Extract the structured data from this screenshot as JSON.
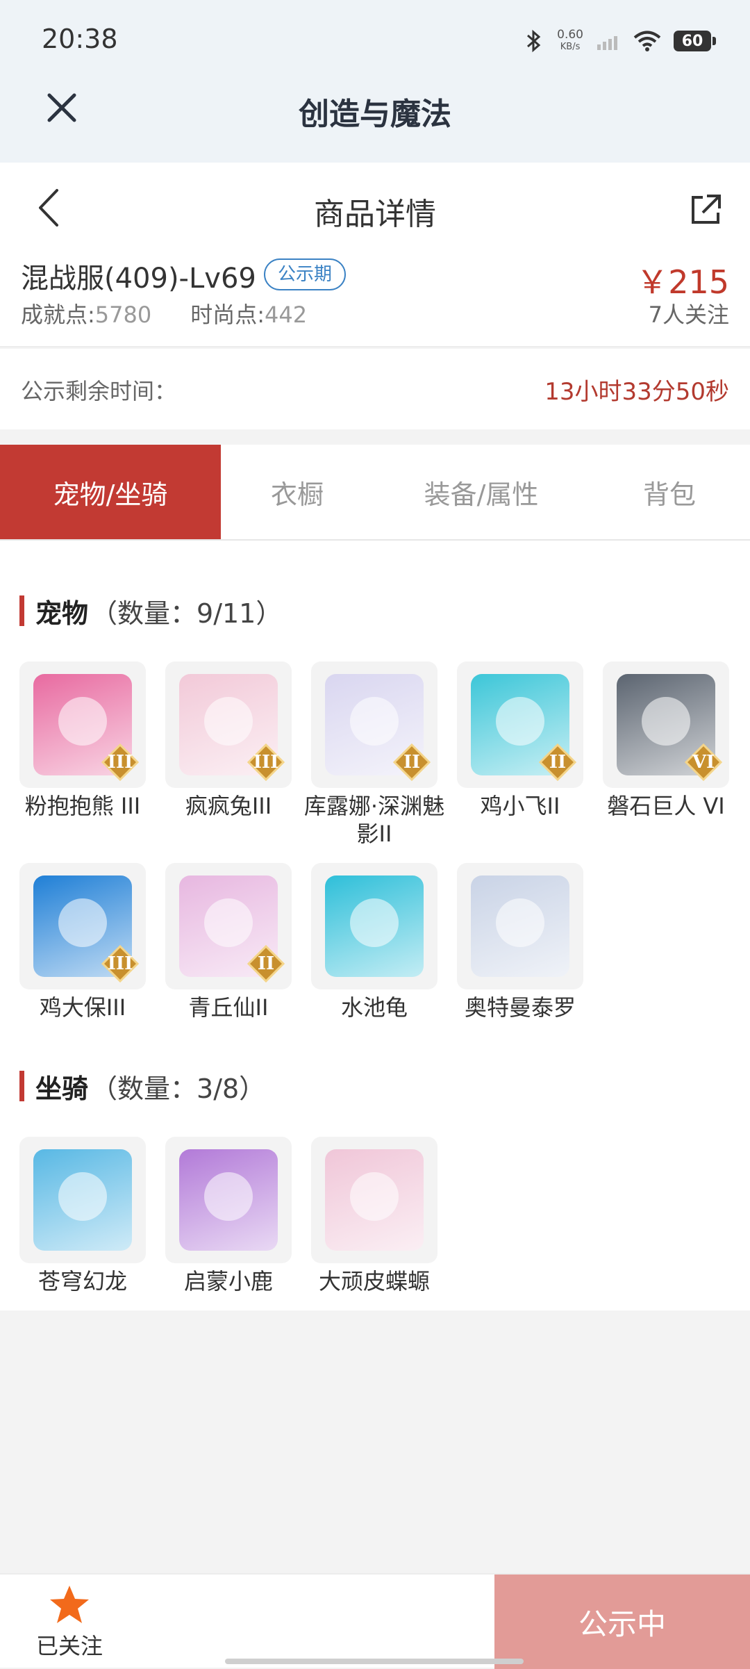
{
  "status_bar": {
    "time": "20:38",
    "net_speed": "0.60",
    "net_unit": "KB/s",
    "battery": "60"
  },
  "app_header": {
    "title": "创造与魔法"
  },
  "nav": {
    "title": "商品详情"
  },
  "product": {
    "name": "混战服(409)-Lv69",
    "tag": "公示期",
    "price": "￥215",
    "achievement_label": "成就点:",
    "achievement_value": "5780",
    "fashion_label": "时尚点:",
    "fashion_value": "442",
    "watchers": "7人关注"
  },
  "countdown": {
    "label": "公示剩余时间：",
    "value": "13小时33分50秒"
  },
  "tabs": [
    {
      "label": "宠物/坐骑",
      "active": true
    },
    {
      "label": "衣橱",
      "active": false
    },
    {
      "label": "装备/属性",
      "active": false
    },
    {
      "label": "背包",
      "active": false
    }
  ],
  "pets": {
    "title": "宠物",
    "count": "（数量：9/11）",
    "items": [
      {
        "name": "粉抱抱熊 III",
        "badge": "III",
        "icon": "pink-bear-icon",
        "color": "#e86aa0"
      },
      {
        "name": "疯疯兔III",
        "badge": "III",
        "icon": "crazy-rabbit-icon",
        "color": "#f2c9d8"
      },
      {
        "name": "库露娜·深渊魅影II",
        "badge": "II",
        "icon": "kuluna-icon",
        "color": "#d9d6f0"
      },
      {
        "name": "鸡小飞II",
        "badge": "II",
        "icon": "chick-icon",
        "color": "#3cc6d8"
      },
      {
        "name": "磐石巨人 VI",
        "badge": "VI",
        "icon": "rock-giant-icon",
        "color": "#5b6470"
      },
      {
        "name": "鸡大保III",
        "badge": "III",
        "icon": "blue-bird-icon",
        "color": "#1f7fd6"
      },
      {
        "name": "青丘仙II",
        "badge": "II",
        "icon": "fox-fairy-icon",
        "color": "#e7b7e0"
      },
      {
        "name": "水池龟",
        "badge": "",
        "icon": "pool-turtle-icon",
        "color": "#2ebfd9"
      },
      {
        "name": "奥特曼泰罗",
        "badge": "",
        "icon": "ultraman-taro-icon",
        "color": "#c9d3e6"
      }
    ]
  },
  "mounts": {
    "title": "坐骑",
    "count": "（数量：3/8）",
    "items": [
      {
        "name": "苍穹幻龙",
        "badge": "",
        "icon": "sky-dragon-icon",
        "color": "#58b8e4"
      },
      {
        "name": "启蒙小鹿",
        "badge": "",
        "icon": "little-deer-icon",
        "color": "#b27ad8"
      },
      {
        "name": "大顽皮蝶螈",
        "badge": "",
        "icon": "axolotl-icon",
        "color": "#f0c6d8"
      }
    ]
  },
  "bottom_bar": {
    "follow_label": "已关注",
    "status_button": "公示中"
  },
  "colors": {
    "accent": "#c23a33",
    "price": "#c0392b",
    "tag": "#3b82c4",
    "badge": "#c8902e"
  }
}
